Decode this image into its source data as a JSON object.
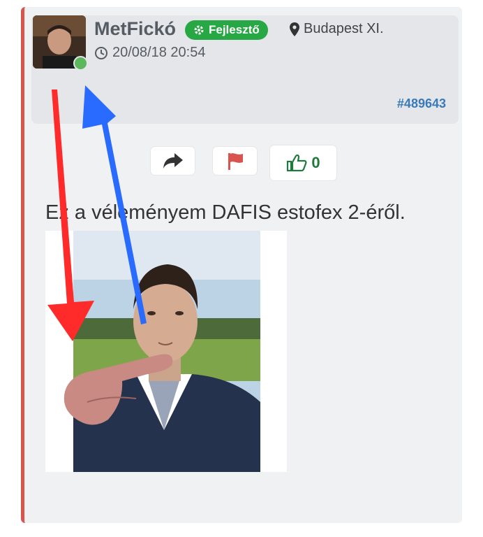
{
  "user": {
    "name": "MetFickó",
    "role": "Fejlesztő",
    "location": "Budapest XI.",
    "timestamp": "20/08/18 20:54",
    "online": true
  },
  "post": {
    "id": "#489643",
    "text": "Ez a véleményem DAFIS estofex 2-éről."
  },
  "actions": {
    "like_count": "0"
  },
  "icons": [
    "gear-icon",
    "map-marker-icon",
    "clock-icon",
    "share-icon",
    "flag-icon",
    "thumbs-up-icon"
  ],
  "colors": {
    "accent_border": "#d9534f",
    "badge_green": "#28a745",
    "link_blue": "#3b7ab8",
    "like_green": "#1e7a3c",
    "flag_red": "#d9534f",
    "annotation_red": "#ff2a2a",
    "annotation_blue": "#2a6bff"
  }
}
